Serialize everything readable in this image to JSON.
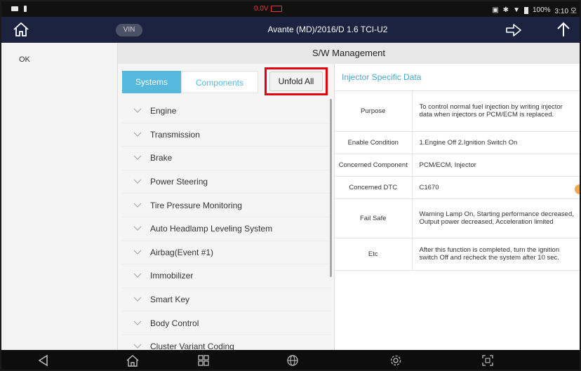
{
  "status_bar": {
    "voltage": "0.0V",
    "battery_percent": "100%",
    "time": "3:10 오"
  },
  "header": {
    "vin_label": "VIN",
    "vehicle": "Avante (MD)/2016/D 1.6 TCI-U2"
  },
  "sidebar": {
    "ok_label": "OK"
  },
  "main": {
    "title": "S/W Management",
    "tabs": [
      {
        "label": "Systems",
        "active": true
      },
      {
        "label": "Components",
        "active": false
      }
    ],
    "unfold_all_label": "Unfold All",
    "systems": [
      "Engine",
      "Transmission",
      "Brake",
      "Power Steering",
      "Tire Pressure Monitoring",
      "Auto Headlamp Leveling System",
      "Airbag(Event #1)",
      "Immobilizer",
      "Smart Key",
      "Body Control",
      "Cluster Variant Coding"
    ]
  },
  "detail": {
    "title": "Injector Specific Data",
    "rows": [
      {
        "key": "Purpose",
        "value": "To control normal fuel injection by writing injector data when injectors or PCM/ECM is replaced."
      },
      {
        "key": "Enable Condition",
        "value": "1.Engine Off 2.Ignition Switch On"
      },
      {
        "key": "Concerned Component",
        "value": "PCM/ECM, Injector"
      },
      {
        "key": "Concerned DTC",
        "value": "C1670"
      },
      {
        "key": "Fail Safe",
        "value": "Warning Lamp On, Starting performance decreased, Output power decreased, Acceleration limited"
      },
      {
        "key": "Etc",
        "value": "After this function is completed, turn the ignition switch Off and recheck the system after 10 sec."
      }
    ]
  },
  "colors": {
    "accent": "#57b8de",
    "header_bg": "#1b2340",
    "highlight": "#e8000c"
  },
  "icons": {
    "header_home": "home-icon",
    "next": "arrow-right-icon",
    "up": "arrow-up-icon",
    "nav_back": "back-triangle-icon",
    "nav_home": "home-outline-icon",
    "nav_apps": "grid-icon",
    "nav_web": "globe-icon",
    "nav_settings": "gear-icon",
    "nav_capture": "screen-capture-icon"
  }
}
